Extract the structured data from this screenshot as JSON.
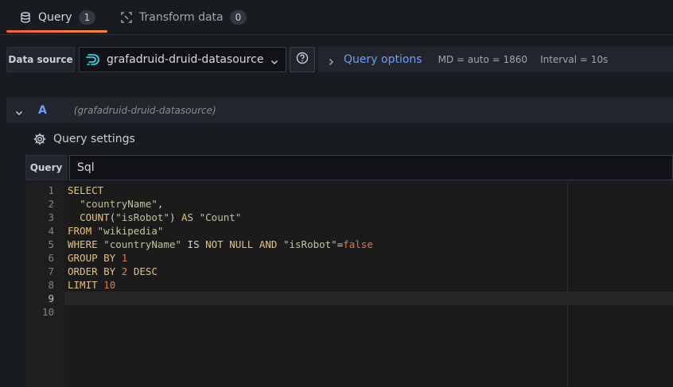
{
  "tabs": [
    {
      "label": "Query",
      "count": "1"
    },
    {
      "label": "Transform data",
      "count": "0"
    }
  ],
  "datasource": {
    "label": "Data source",
    "selected": "grafadruid-druid-datasource"
  },
  "query_options": {
    "title": "Query options",
    "md": "MD = auto = 1860",
    "interval": "Interval = 10s"
  },
  "query_row": {
    "ref_id": "A",
    "datasource_name": "(grafadruid-druid-datasource)"
  },
  "query_settings": {
    "title": "Query settings",
    "query_label": "Query",
    "query_type": "Sql"
  },
  "editor": {
    "line_numbers": [
      "1",
      "2",
      "3",
      "4",
      "5",
      "6",
      "7",
      "8",
      "9",
      "10"
    ],
    "lines": [
      [
        {
          "t": "SELECT",
          "c": "kw"
        }
      ],
      [
        {
          "t": "  ",
          "c": "pl"
        },
        {
          "t": "\"countryName\"",
          "c": "str"
        },
        {
          "t": ",",
          "c": "pl"
        }
      ],
      [
        {
          "t": "  ",
          "c": "pl"
        },
        {
          "t": "COUNT",
          "c": "kw"
        },
        {
          "t": "(",
          "c": "pl"
        },
        {
          "t": "\"isRobot\"",
          "c": "str"
        },
        {
          "t": ") ",
          "c": "pl"
        },
        {
          "t": "AS",
          "c": "kw"
        },
        {
          "t": " ",
          "c": "pl"
        },
        {
          "t": "\"Count\"",
          "c": "str"
        }
      ],
      [
        {
          "t": "FROM",
          "c": "kw"
        },
        {
          "t": " ",
          "c": "pl"
        },
        {
          "t": "\"wikipedia\"",
          "c": "str"
        }
      ],
      [
        {
          "t": "WHERE",
          "c": "kw"
        },
        {
          "t": " ",
          "c": "pl"
        },
        {
          "t": "\"countryName\"",
          "c": "str"
        },
        {
          "t": " IS ",
          "c": "pl"
        },
        {
          "t": "NOT NULL AND",
          "c": "kw"
        },
        {
          "t": " ",
          "c": "pl"
        },
        {
          "t": "\"isRobot\"",
          "c": "str"
        },
        {
          "t": "=",
          "c": "pl"
        },
        {
          "t": "false",
          "c": "num"
        }
      ],
      [
        {
          "t": "GROUP BY",
          "c": "kw"
        },
        {
          "t": " ",
          "c": "pl"
        },
        {
          "t": "1",
          "c": "num"
        }
      ],
      [
        {
          "t": "ORDER BY",
          "c": "kw"
        },
        {
          "t": " ",
          "c": "pl"
        },
        {
          "t": "2",
          "c": "num"
        },
        {
          "t": " ",
          "c": "pl"
        },
        {
          "t": "DESC",
          "c": "kw"
        }
      ],
      [
        {
          "t": "LIMIT",
          "c": "kw"
        },
        {
          "t": " ",
          "c": "pl"
        },
        {
          "t": "10",
          "c": "num"
        }
      ],
      [],
      []
    ]
  },
  "colors": {
    "accent": "#6e9fff",
    "tab_underline": "#f55f3e"
  }
}
